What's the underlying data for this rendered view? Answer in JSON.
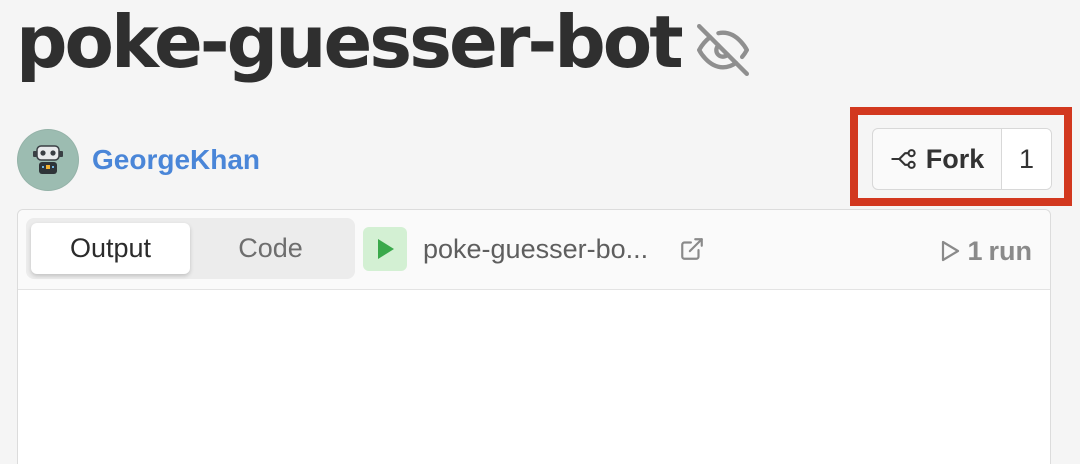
{
  "repl": {
    "title": "poke-guesser-bot",
    "visibility_icon": "eye-off-icon"
  },
  "author": {
    "name": "GeorgeKhan",
    "avatar_icon": "robot-avatar-icon"
  },
  "fork": {
    "label": "Fork",
    "count": "1",
    "icon": "fork-icon",
    "highlight_color": "#d2381f"
  },
  "panel": {
    "tabs": [
      {
        "label": "Output",
        "active": true
      },
      {
        "label": "Code",
        "active": false
      }
    ],
    "run_icon": "play-icon",
    "repl_link_text": "poke-guesser-bo...",
    "external_icon": "external-link-icon",
    "runs": {
      "count": "1",
      "unit": "run"
    }
  },
  "colors": {
    "link": "#4a86d8",
    "run_button_bg": "#d3f0d3",
    "run_button_fg": "#3aa94b"
  }
}
